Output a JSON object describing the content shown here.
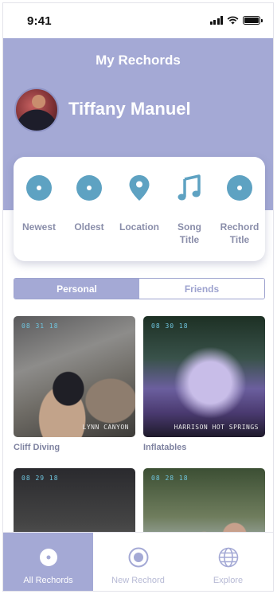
{
  "status_bar": {
    "time": "9:41"
  },
  "header": {
    "title": "My Rechords",
    "profile_name": "Tiffany Manuel"
  },
  "sort_options": [
    {
      "label": "Newest",
      "icon": "disc-icon"
    },
    {
      "label": "Oldest",
      "icon": "disc-icon"
    },
    {
      "label": "Location",
      "icon": "location-pin-icon"
    },
    {
      "label": "Song\nTitle",
      "icon": "music-note-icon"
    },
    {
      "label": "Rechord\nTitle",
      "icon": "disc-icon"
    }
  ],
  "segment": {
    "personal": "Personal",
    "friends": "Friends",
    "selected": "Personal"
  },
  "rechords": [
    {
      "date": "08 31 18",
      "place": "LYNN CANYON",
      "title": "Cliff Diving"
    },
    {
      "date": "08 30 18",
      "place": "HARRISON HOT SPRINGS",
      "title": "Inflatables"
    },
    {
      "date": "08 29 18",
      "place": "",
      "title": ""
    },
    {
      "date": "08 28 18",
      "place": "",
      "title": ""
    }
  ],
  "tab_bar": {
    "items": [
      {
        "label": "All Rechords",
        "icon": "disc-icon",
        "active": true
      },
      {
        "label": "New Rechord",
        "icon": "record-button-icon",
        "active": false
      },
      {
        "label": "Explore",
        "icon": "globe-icon",
        "active": false
      }
    ]
  },
  "colors": {
    "accent": "#a4a9d5",
    "icon_blue": "#5ea2c2",
    "text_muted": "#8a8eaa",
    "date_stamp": "#6fc6e0"
  }
}
